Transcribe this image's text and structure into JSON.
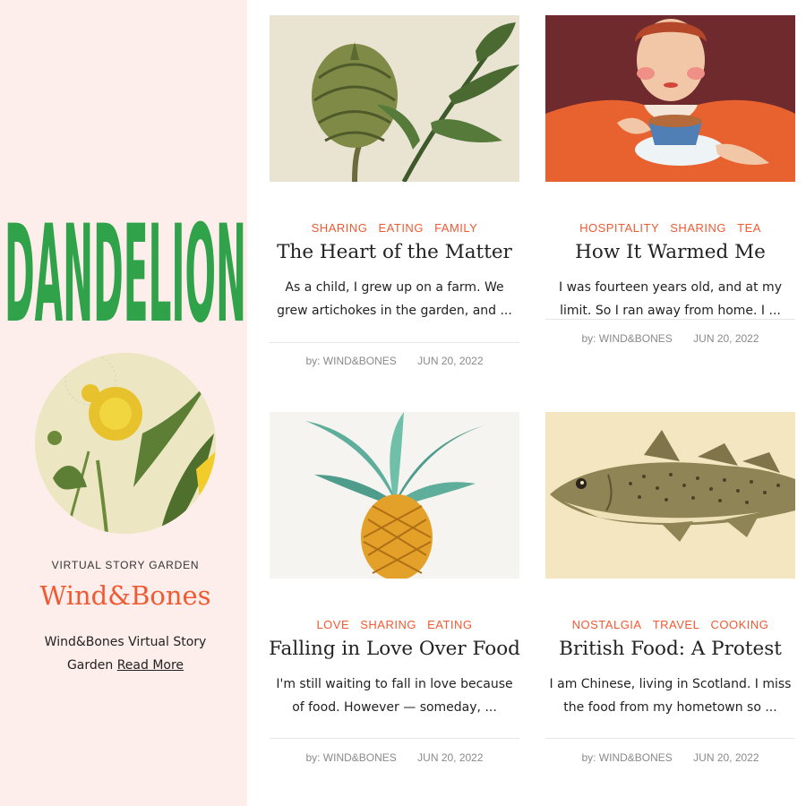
{
  "sidebar": {
    "logo": "DANDELION",
    "logo_color": "#2fa24a",
    "avatar_image": "dandelion-botanical-illustration",
    "kicker": "VIRTUAL STORY GARDEN",
    "site_title": "Wind&Bones",
    "description": "Wind&Bones Virtual Story Garden",
    "read_more": "Read More",
    "background": "#fdeeeb"
  },
  "accent_color": "#f05a33",
  "posts": [
    {
      "image": "artichoke-botanical-illustration",
      "tags": [
        "SHARING",
        "EATING",
        "FAMILY"
      ],
      "title": "The Heart of the Matter",
      "excerpt": "As a child, I grew up on a farm. We grew artichokes in the garden, and ...",
      "author": "by: WIND&BONES",
      "date": "JUN 20, 2022"
    },
    {
      "image": "woman-drinking-tea-illustration",
      "tags": [
        "HOSPITALITY",
        "SHARING",
        "TEA"
      ],
      "title": "How It Warmed Me",
      "excerpt": "I was fourteen years old, and at my limit. So I ran away from home. I ...",
      "author": "by: WIND&BONES",
      "date": "JUN 20, 2022"
    },
    {
      "image": "pineapple-botanical-illustration",
      "tags": [
        "LOVE",
        "SHARING",
        "EATING"
      ],
      "title": "Falling in Love Over Food",
      "excerpt": "I'm still waiting to fall in love because of food. However — someday, ...",
      "author": "by: WIND&BONES",
      "date": "JUN 20, 2022"
    },
    {
      "image": "cod-fish-illustration",
      "tags": [
        "NOSTALGIA",
        "TRAVEL",
        "COOKING"
      ],
      "title": "British Food: A Protest",
      "excerpt": "I am Chinese, living in Scotland. I miss the food from my hometown so ...",
      "author": "by: WIND&BONES",
      "date": "JUN 20, 2022"
    }
  ]
}
